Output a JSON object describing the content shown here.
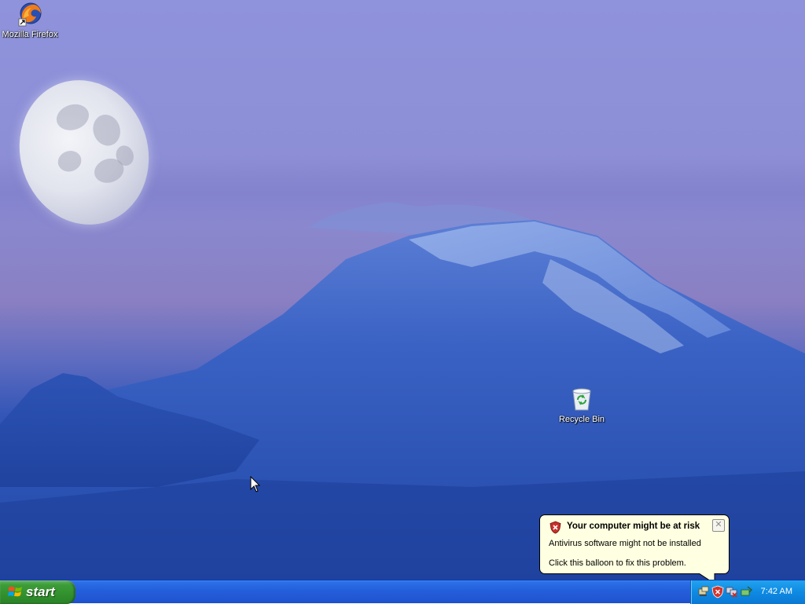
{
  "desktop": {
    "icons": [
      {
        "label": "Mozilla Firefox",
        "icon": "firefox-icon"
      },
      {
        "label": "Recycle Bin",
        "icon": "recycle-bin-icon"
      }
    ]
  },
  "balloon": {
    "title": "Your computer might be at risk",
    "line1": "Antivirus software might not be installed",
    "line2": "Click this balloon to fix this problem.",
    "icon": "security-shield-icon",
    "close_glyph": "✕"
  },
  "taskbar": {
    "start_label": "start",
    "clock": "7:42 AM",
    "tray_icons": [
      "network-icon",
      "security-center-icon",
      "network-connection-icon",
      "safely-remove-hardware-icon"
    ]
  },
  "colors": {
    "taskbar": "#245edb",
    "start_button": "#3c9c38",
    "tray": "#0e8ae3",
    "balloon_bg": "#ffffe1"
  }
}
